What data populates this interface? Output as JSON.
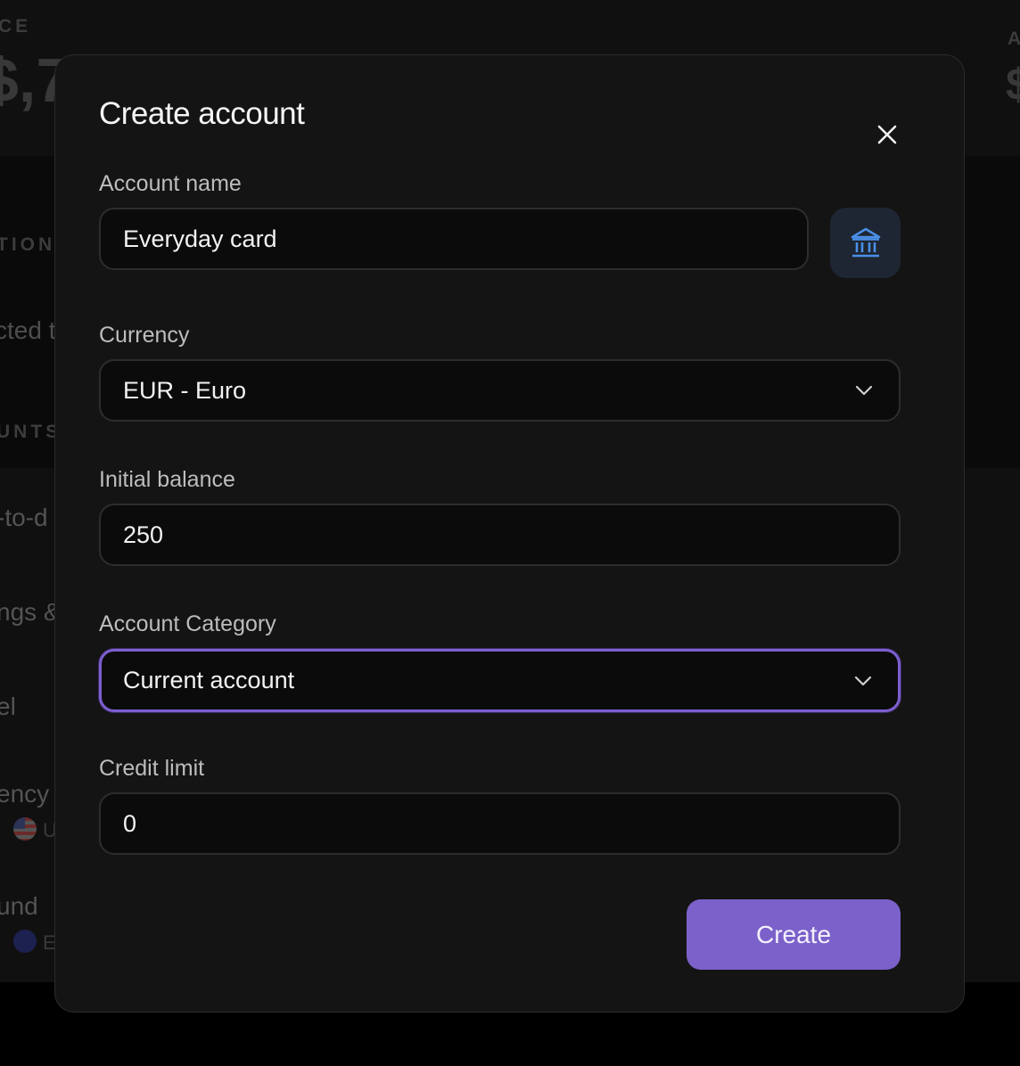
{
  "background": {
    "balance_caption": "CE",
    "balance_value": "$,7",
    "right_caption": "A",
    "right_value": "$",
    "section_caption": "TION",
    "section_text": "cted t",
    "accounts_caption": "UNTS",
    "items": [
      {
        "label": "-to-d"
      },
      {
        "label": "ngs &"
      },
      {
        "label": "el"
      },
      {
        "label": "ency",
        "sub": "U"
      },
      {
        "label": "und",
        "sub": "E"
      }
    ]
  },
  "modal": {
    "title": "Create account",
    "close_icon": "close-icon",
    "fields": {
      "account_name": {
        "label": "Account name",
        "value": "Everyday card"
      },
      "currency": {
        "label": "Currency",
        "value": "EUR - Euro"
      },
      "initial_balance": {
        "label": "Initial balance",
        "value": "250"
      },
      "account_category": {
        "label": "Account Category",
        "value": "Current account"
      },
      "credit_limit": {
        "label": "Credit limit",
        "value": "0"
      }
    },
    "account_icon": "bank-icon",
    "submit_label": "Create"
  },
  "colors": {
    "accent": "#7b61c9",
    "focus_border": "#7c5fcf",
    "icon_blue": "#4a8fe7",
    "modal_bg": "#141414",
    "input_bg": "#0b0b0b"
  }
}
